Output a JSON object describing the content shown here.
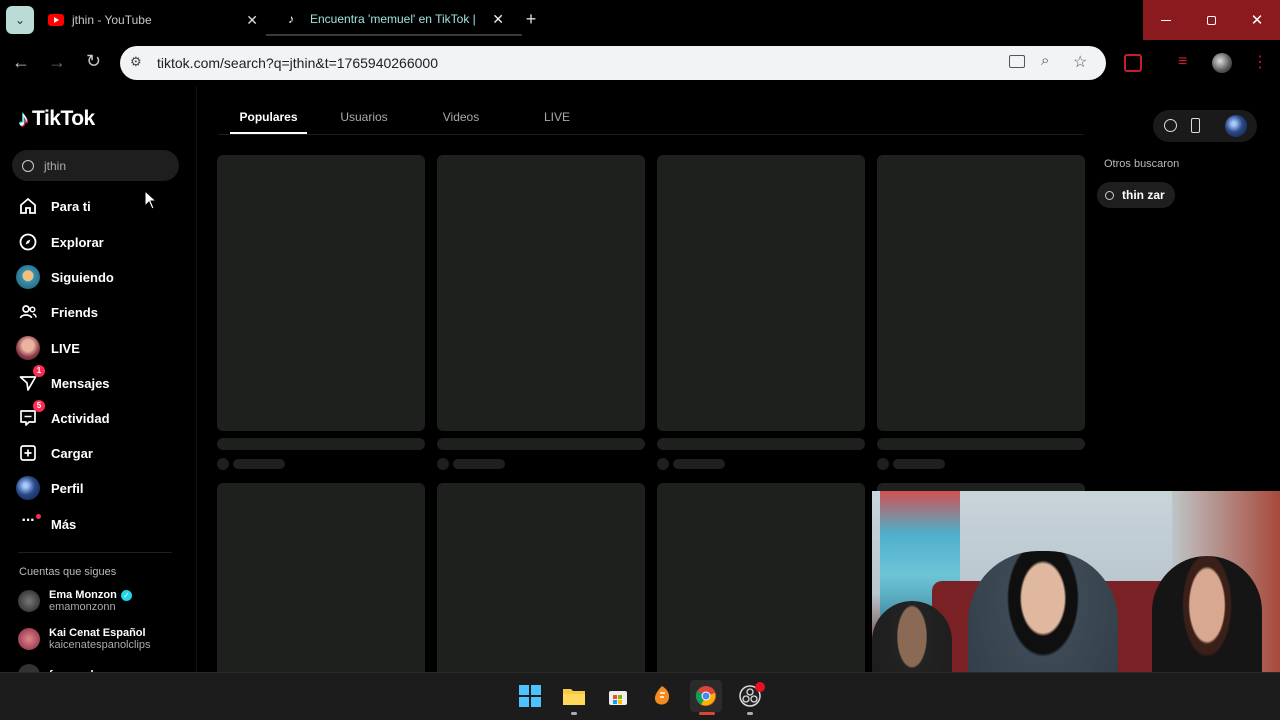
{
  "browser": {
    "tabs": [
      {
        "title": "jthin - YouTube"
      },
      {
        "title": "Encuentra 'memuel' en TikTok |"
      }
    ],
    "url": "tiktok.com/search?q=jthin&t=1765940266000"
  },
  "tiktok": {
    "logo": "TikTok",
    "search_value": "jthin",
    "nav": [
      {
        "label": "Para ti"
      },
      {
        "label": "Explorar"
      },
      {
        "label": "Siguiendo"
      },
      {
        "label": "Friends"
      },
      {
        "label": "LIVE"
      },
      {
        "label": "Mensajes",
        "badge": "1"
      },
      {
        "label": "Actividad",
        "badge": "5"
      },
      {
        "label": "Cargar"
      },
      {
        "label": "Perfil"
      },
      {
        "label": "Más"
      }
    ],
    "following_title": "Cuentas que sigues",
    "following": [
      {
        "name": "Ema Monzon",
        "handle": "emamonzonn"
      },
      {
        "name": "Kai Cenat Español",
        "handle": "kaicenatespanolclips"
      },
      {
        "name": "fomorod",
        "handle": ""
      }
    ],
    "tabs": [
      "Populares",
      "Usuarios",
      "Videos",
      "LIVE"
    ],
    "others_title": "Otros buscaron",
    "others": [
      "thin zar"
    ]
  },
  "colors": {
    "accent": "#fe2c55",
    "verified": "#20d5ec",
    "card": "#1e201e"
  }
}
